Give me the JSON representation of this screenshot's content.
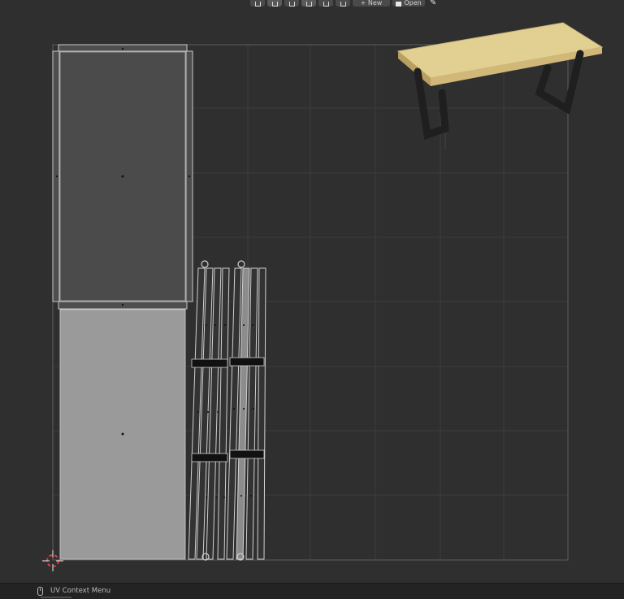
{
  "header": {
    "new_label": "New",
    "open_label": "Open",
    "buttons": [
      {
        "name": "view-mode",
        "icon": "select-icon"
      },
      {
        "name": "sticky-select",
        "icon": "vertex-icon"
      },
      {
        "name": "pivot",
        "icon": "pivot-icon"
      },
      {
        "name": "proportional-edit",
        "icon": "proportional-icon"
      },
      {
        "name": "falloff",
        "icon": "falloff-icon"
      },
      {
        "name": "image-browse",
        "icon": "image-icon"
      }
    ],
    "pin_icon": "pin-icon"
  },
  "viewport": {
    "background": "#2f2f2f",
    "uv_face_fill": "#9a9a9a",
    "uv_face_fill_dark": "#4a4a4a",
    "edge_color": "#cfcfcf"
  },
  "preview": {
    "subject": "wooden-table-with-black-legs",
    "top_color": "#e3cf93",
    "leg_color": "#222222"
  },
  "status": {
    "mouse_icon": "mouse-right-icon",
    "text": "UV Context Menu"
  }
}
